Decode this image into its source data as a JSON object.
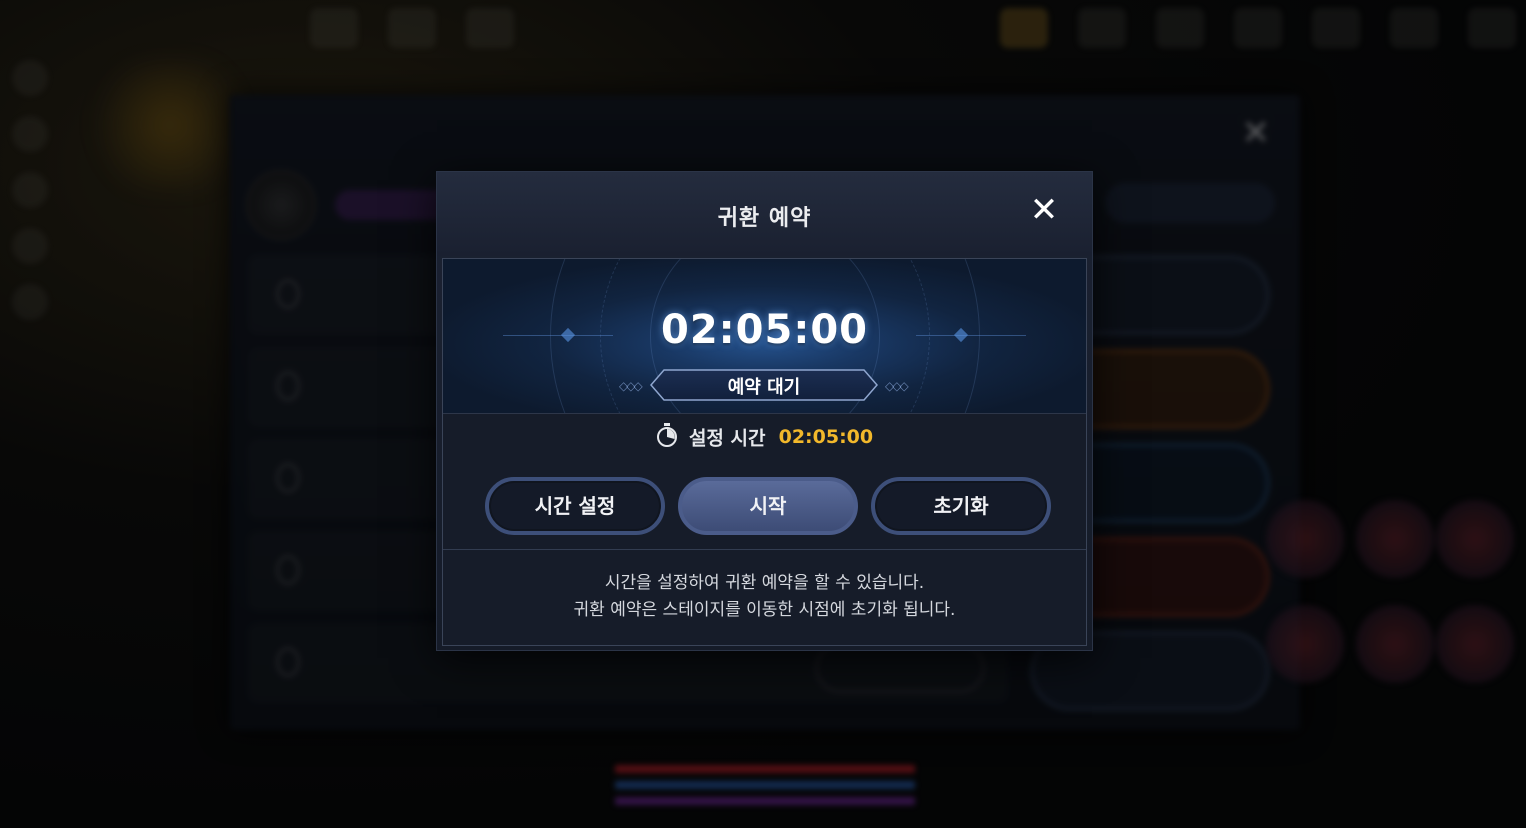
{
  "modal": {
    "title": "귀환 예약",
    "close_icon": "close-icon",
    "timer": {
      "display": "02:05:00",
      "status": "예약 대기"
    },
    "set_time": {
      "icon": "stopwatch-icon",
      "label": "설정 시간",
      "value": "02:05:00",
      "value_color": "#f2b82b"
    },
    "buttons": {
      "set_time": "시간 설정",
      "start": "시작",
      "reset": "초기화"
    },
    "description": {
      "line1": "시간을 설정하여 귀환 예약을 할 수 있습니다.",
      "line2": "귀환 예약은 스테이지를 이동한 시점에 초기화 됩니다."
    }
  }
}
